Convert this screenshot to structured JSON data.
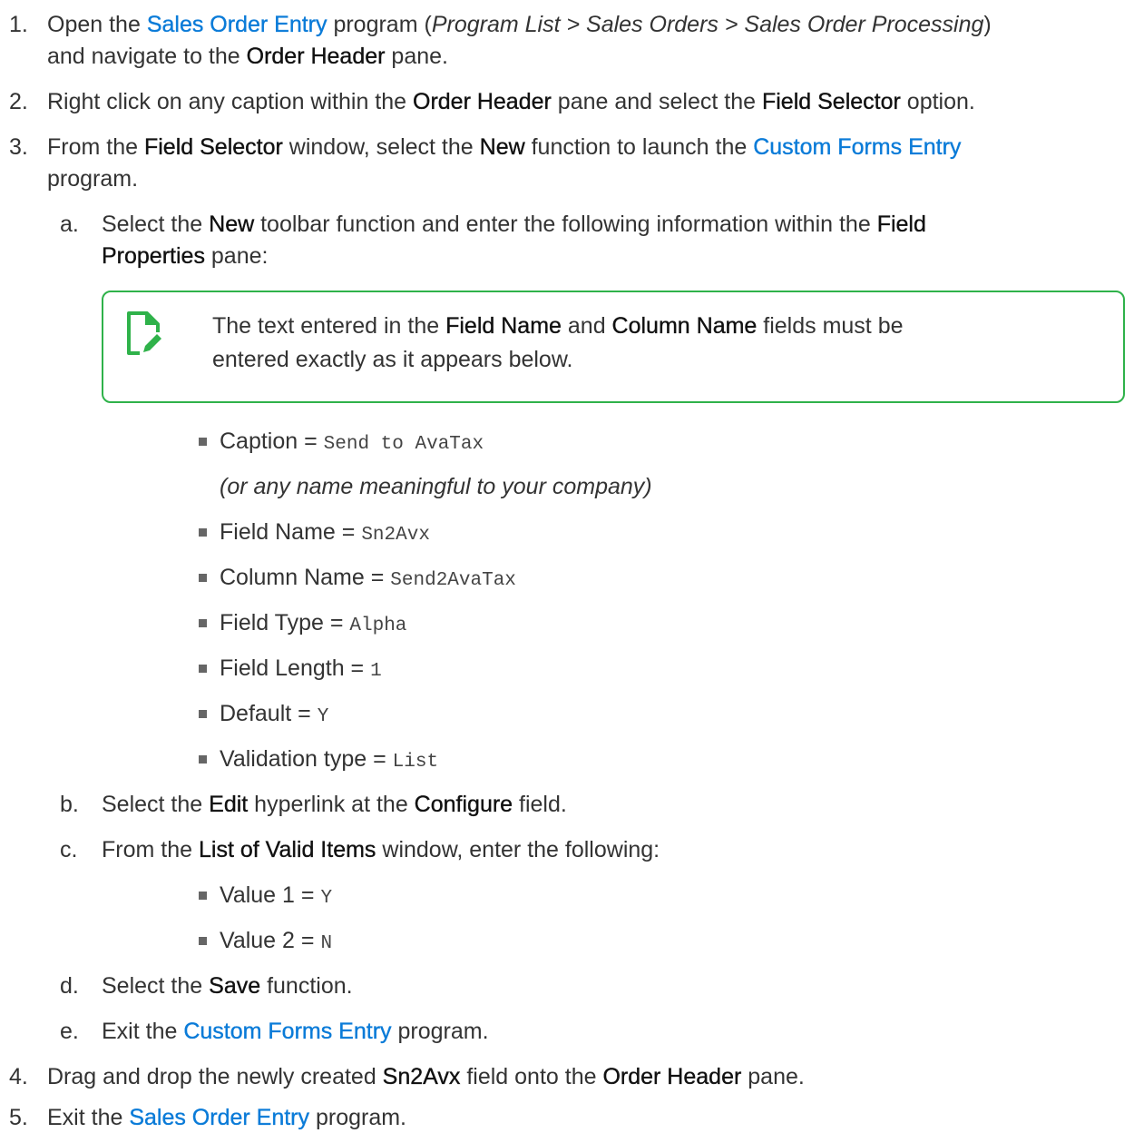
{
  "steps": {
    "s1": {
      "num": "1.",
      "t1": "Open the ",
      "link": "Sales Order Entry",
      "t2": " program (",
      "path": "Program List > Sales Orders > Sales Order Processing",
      "t3": ")",
      "t4": "and navigate to the ",
      "b1": "Order Header",
      "t5": " pane."
    },
    "s2": {
      "num": "2.",
      "t1": "Right click on any caption within the ",
      "b1": "Order Header",
      "t2": " pane and select the ",
      "b2": "Field Selector",
      "t3": " option."
    },
    "s3": {
      "num": "3.",
      "t1": "From the ",
      "b1": "Field Selector",
      "t2": " window, select the ",
      "b2": "New",
      "t3": " function to launch the ",
      "link": "Custom Forms Entry",
      "t4": "program."
    },
    "sa": {
      "num": "a.",
      "t1": "Select the ",
      "b1": "New",
      "t2": " toolbar function and enter the following information within the ",
      "b2": "Field",
      "b3": "Properties",
      "t3": " pane:"
    },
    "note": {
      "t1": "The text entered in the ",
      "b1": "Field Name",
      "t2": " and ",
      "b2": "Column Name",
      "t3": " fields must be",
      "t4": "entered exactly as it appears below."
    },
    "fields": [
      {
        "label": "Caption",
        "eq": " = ",
        "value": "Send to AvaTax"
      },
      {
        "label": "Field Name",
        "eq": " = ",
        "value": "Sn2Avx"
      },
      {
        "label": "Column Name",
        "eq": " = ",
        "value": "Send2AvaTax"
      },
      {
        "label": "Field Type",
        "eq": " = ",
        "value": "Alpha"
      },
      {
        "label": "Field Length",
        "eq": " = ",
        "value": "1"
      },
      {
        "label": "Default",
        "eq": " = ",
        "value": "Y"
      },
      {
        "label": "Validation type",
        "eq": " = ",
        "value": "List"
      }
    ],
    "caption_note": "(or any name meaningful to your company)",
    "sb": {
      "num": "b.",
      "t1": "Select the ",
      "b1": "Edit",
      "t2": " hyperlink at the ",
      "b2": "Configure",
      "t3": " field."
    },
    "sc": {
      "num": "c.",
      "t1": "From the ",
      "b1": "List of Valid Items",
      "t2": " window, enter the following:"
    },
    "values": [
      {
        "label": "Value 1",
        "eq": " = ",
        "value": "Y"
      },
      {
        "label": "Value 2",
        "eq": " = ",
        "value": "N"
      }
    ],
    "sd": {
      "num": "d.",
      "t1": "Select the ",
      "b1": "Save",
      "t2": " function."
    },
    "se": {
      "num": "e.",
      "t1": "Exit the ",
      "link": "Custom Forms Entry",
      "t2": " program."
    },
    "s4": {
      "num": "4.",
      "t1": "Drag and drop the newly created ",
      "b1": "Sn2Avx",
      "t2": " field onto the ",
      "b2": "Order Header",
      "t3": " pane."
    },
    "s5": {
      "num": "5.",
      "t1": "Exit the ",
      "link": "Sales Order Entry",
      "t2": " program."
    }
  }
}
